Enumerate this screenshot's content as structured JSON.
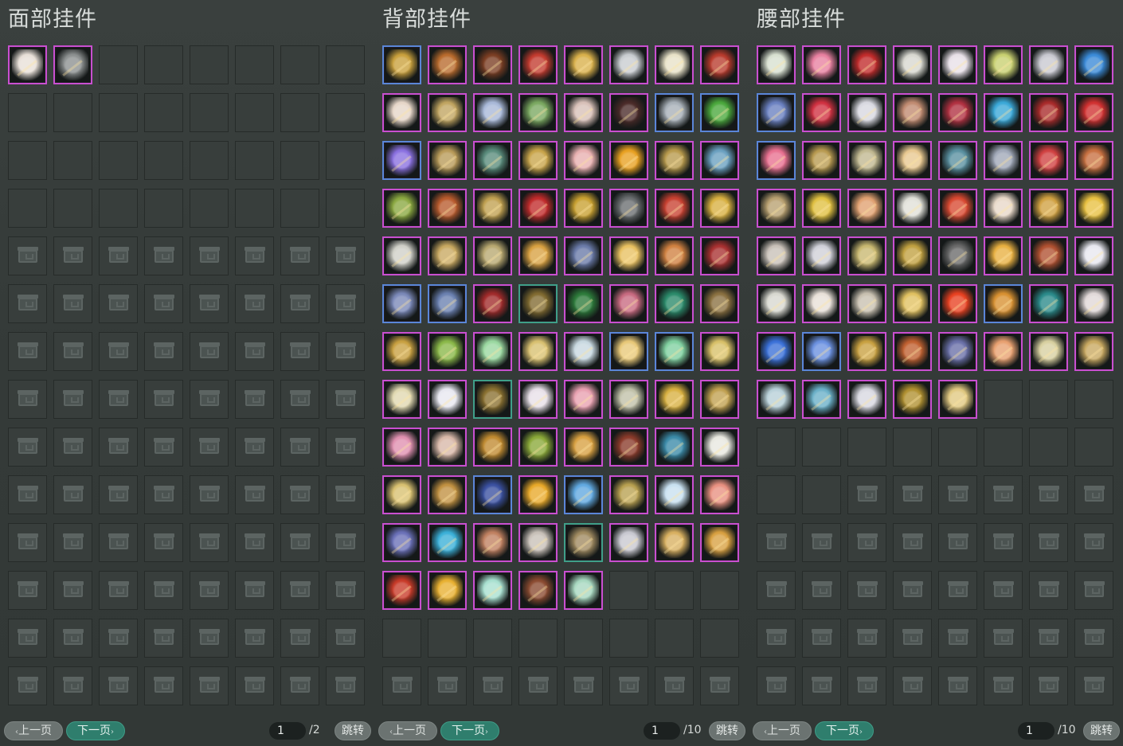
{
  "panels": [
    {
      "id": "face",
      "title": "面部挂件",
      "filled": 2,
      "empty_unlocked": 30,
      "total": 112,
      "colors": [
        "#e8e0d8",
        "#8c9090"
      ],
      "borders": [
        "p",
        "p"
      ],
      "footer": {
        "prev": "上一页",
        "next": "下一页",
        "page": "1",
        "total": "/2",
        "jump": "跳转"
      }
    },
    {
      "id": "back",
      "title": "背部挂件",
      "filled": 93,
      "empty_unlocked": 11,
      "total": 112,
      "colors": [
        "#c9a03c",
        "#b86a2c",
        "#7a3d22",
        "#c23a2e",
        "#d9b04a",
        "#c8ccd0",
        "#e8e2c8",
        "#b83a2c",
        "#e6d6c8",
        "#c0a460",
        "#a8b8d8",
        "#7aa860",
        "#d8c0b8",
        "#4a2a28",
        "#a8b0b8",
        "#4aa83c",
        "#8a70e0",
        "#b89a58",
        "#5a8c7c",
        "#c8a44a",
        "#e8b0b0",
        "#e8a020",
        "#b89a4c",
        "#6aa0c0",
        "#8aa840",
        "#b85a2c",
        "#c0a050",
        "#c02a2a",
        "#c8a030",
        "#6a6e70",
        "#c84030",
        "#d8b040",
        "#d0d0c8",
        "#c8a860",
        "#b8a870",
        "#d8a040",
        "#6a7aa8",
        "#e8c060",
        "#d08040",
        "#a83030",
        "#7a88b8",
        "#6a80b0",
        "#a02a2a",
        "#806a30",
        "#2c7a3a",
        "#c86a80",
        "#2a8a6a",
        "#8a7040",
        "#c8a040",
        "#8ab848",
        "#9ad8a0",
        "#d8c070",
        "#c8d8e0",
        "#e8c878",
        "#80d0a0",
        "#d8c068",
        "#e0d8b0",
        "#e8e8f0",
        "#8a7030",
        "#e8e0e8",
        "#e8a0b0",
        "#c0c0a8",
        "#d8b040",
        "#c0a050",
        "#e090b0",
        "#d8b8a8",
        "#c08a30",
        "#8aa838",
        "#d8a040",
        "#8a3a2a",
        "#3a8aa8",
        "#e8e8e0",
        "#d8c070",
        "#c09040",
        "#3a50a0",
        "#e8a828",
        "#60a8e0",
        "#b8a050",
        "#c8e0f0",
        "#e89080",
        "#6a70b8",
        "#3ab0d8",
        "#c08060",
        "#c8c0b8",
        "#a08a60",
        "#c8c8d0",
        "#d8b060",
        "#d8a040",
        "#c83a28",
        "#e8b030",
        "#a8e0d0",
        "#8a4a30",
        "#a8d8c0"
      ],
      "borders": [
        "b",
        "p",
        "p",
        "p",
        "p",
        "p",
        "p",
        "p",
        "p",
        "p",
        "p",
        "p",
        "p",
        "p",
        "b",
        "b",
        "b",
        "p",
        "p",
        "p",
        "p",
        "p",
        "p",
        "p",
        "p",
        "p",
        "p",
        "p",
        "p",
        "p",
        "p",
        "p",
        "p",
        "p",
        "p",
        "p",
        "p",
        "p",
        "p",
        "p",
        "b",
        "b",
        "p",
        "t",
        "p",
        "p",
        "p",
        "p",
        "p",
        "p",
        "p",
        "p",
        "p",
        "b",
        "b",
        "p",
        "p",
        "p",
        "t",
        "p",
        "p",
        "p",
        "p",
        "p",
        "p",
        "p",
        "p",
        "p",
        "p",
        "p",
        "p",
        "p",
        "p",
        "p",
        "b",
        "p",
        "b",
        "p",
        "p",
        "p",
        "p",
        "p",
        "p",
        "p",
        "t",
        "p",
        "p",
        "p",
        "p",
        "p",
        "p",
        "p",
        "p"
      ],
      "footer": {
        "prev": "上一页",
        "next": "下一页",
        "page": "1",
        "total": "/10",
        "jump": "跳转"
      }
    },
    {
      "id": "waist",
      "title": "腰部挂件",
      "filled": 61,
      "empty_unlocked": 13,
      "total": 112,
      "colors": [
        "#d8e0d0",
        "#e880a0",
        "#c02a2a",
        "#d8d8d0",
        "#e8e0e8",
        "#c8d070",
        "#c8c8d0",
        "#3a8ad8",
        "#6a80c0",
        "#d03040",
        "#d8d8e0",
        "#c08a70",
        "#b03040",
        "#3aa8d8",
        "#a82a2a",
        "#d03030",
        "#e87090",
        "#b89a50",
        "#c0b890",
        "#e8c890",
        "#5a90a0",
        "#a0a8b8",
        "#d04040",
        "#c87040",
        "#b8a070",
        "#e0c040",
        "#e0a070",
        "#e0e0d8",
        "#d84830",
        "#e8d8c8",
        "#d0a040",
        "#e8c040",
        "#c8c0b8",
        "#d0d0d8",
        "#c8b870",
        "#c0a040",
        "#6a6a6a",
        "#e8b040",
        "#b05030",
        "#e8e8f0",
        "#d8d8d0",
        "#e8e0d8",
        "#c8c0b0",
        "#e0c060",
        "#e84020",
        "#d89030",
        "#2a8a8a",
        "#e0d8d8",
        "#3a70d8",
        "#6a90e0",
        "#c8a040",
        "#c06030",
        "#6a70a8",
        "#e8a070",
        "#d8d0a0",
        "#c8a860",
        "#b8d0d8",
        "#6ab0c8",
        "#d8d8e0",
        "#b09030",
        "#e0c880",
        "#e0e0d8",
        "#e8a040",
        "#b8c8d8",
        "#e890a8",
        "#c88a40",
        "#f0e0a0",
        "#d8d060",
        "#e86030"
      ],
      "borders": [
        "p",
        "p",
        "p",
        "p",
        "p",
        "p",
        "p",
        "p",
        "b",
        "p",
        "p",
        "p",
        "p",
        "p",
        "p",
        "p",
        "b",
        "p",
        "p",
        "p",
        "p",
        "p",
        "p",
        "p",
        "p",
        "p",
        "p",
        "p",
        "p",
        "p",
        "p",
        "p",
        "p",
        "p",
        "p",
        "p",
        "p",
        "p",
        "p",
        "p",
        "p",
        "p",
        "p",
        "p",
        "p",
        "b",
        "p",
        "p",
        "p",
        "b",
        "p",
        "p",
        "p",
        "p",
        "p",
        "p",
        "p",
        "p",
        "p",
        "p",
        "p",
        "p",
        "p",
        "p",
        "p",
        "p",
        "p",
        "p",
        "p"
      ],
      "footer": {
        "prev": "上一页",
        "next": "下一页",
        "page": "1",
        "total": "/10",
        "jump": "跳转"
      }
    }
  ],
  "icons": {
    "locked": "lock-icon",
    "arrow_left": "‹",
    "arrow_right": "›"
  }
}
